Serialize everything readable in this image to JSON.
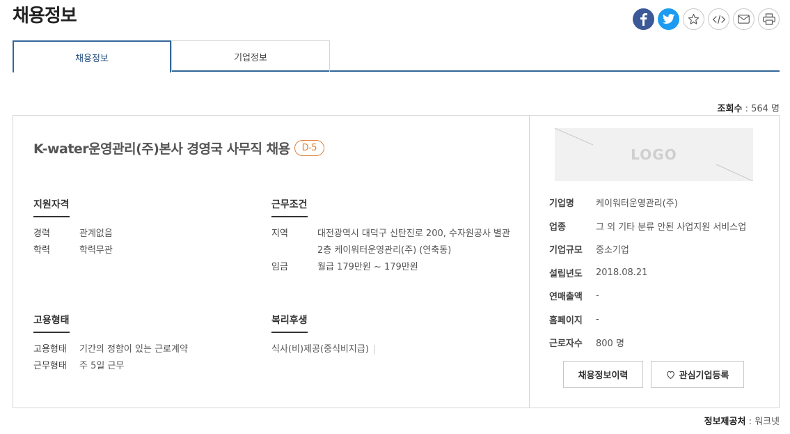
{
  "page": {
    "title": "채용정보"
  },
  "share": [
    {
      "name": "facebook-icon",
      "glyph": "f"
    },
    {
      "name": "twitter-icon",
      "glyph": ""
    },
    {
      "name": "star-icon",
      "glyph": "☆"
    },
    {
      "name": "embed-code-icon",
      "glyph": "</>"
    },
    {
      "name": "mail-icon",
      "glyph": ""
    },
    {
      "name": "print-icon",
      "glyph": ""
    }
  ],
  "tabs": [
    {
      "label": "채용정보",
      "active": true
    },
    {
      "label": "기업정보",
      "active": false
    }
  ],
  "views": {
    "label": "조회수",
    "separator": " : ",
    "value": "564 명"
  },
  "job": {
    "title": "K-water운영관리(주)본사 경영국 사무직 채용",
    "dday": "D-5"
  },
  "qualification": {
    "heading": "지원자격",
    "rows": [
      {
        "key": "경력",
        "value": "관계없음"
      },
      {
        "key": "학력",
        "value": "학력무관"
      }
    ]
  },
  "conditions": {
    "heading": "근무조건",
    "rows": [
      {
        "key": "지역",
        "value": "대전광역시 대덕구 신탄진로 200, 수자원공사 별관2층 케이워터운영관리(주) (연축동)"
      },
      {
        "key": "임금",
        "value": "월급 179만원 ~ 179만원"
      }
    ]
  },
  "employment": {
    "heading": "고용형태",
    "rows": [
      {
        "key": "고용형태",
        "value": "기간의 정함이 있는 근로계약"
      },
      {
        "key": "근무형태",
        "value": "주 5일 근무"
      }
    ]
  },
  "welfare": {
    "heading": "복리후생",
    "value": "식사(비)제공(중식비지급)"
  },
  "company": {
    "logo_text": "LOGO",
    "rows": [
      {
        "key": "기업명",
        "value": "케이워터운영관리(주)"
      },
      {
        "key": "업종",
        "value": "그 외 기타 분류 안된 사업지원 서비스업"
      },
      {
        "key": "기업규모",
        "value": "중소기업"
      },
      {
        "key": "설립년도",
        "value": "2018.08.21"
      },
      {
        "key": "연매출액",
        "value": "-"
      },
      {
        "key": "홈페이지",
        "value": "-"
      },
      {
        "key": "근로자수",
        "value": "800 명"
      }
    ]
  },
  "buttons": {
    "history": "채용정보이력",
    "favorite": "관심기업등록"
  },
  "source": {
    "label": "정보제공처",
    "separator": " : ",
    "value": "워크넷"
  },
  "colors": {
    "accent": "#336699",
    "dday": "#e0823e",
    "facebook": "#3b5998",
    "twitter": "#1d9bf0"
  }
}
